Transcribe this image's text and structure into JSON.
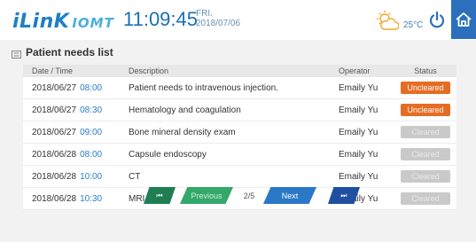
{
  "header": {
    "logo_main": "iLinK",
    "logo_sub": "IOMT",
    "time": "11:09:45",
    "day": "FRI.",
    "date": "2018/07/06",
    "temperature": "25°C",
    "icons": {
      "weather": "partly-cloudy-icon",
      "power": "power-icon",
      "home": "home-icon"
    },
    "accent_color": "#2b6fbd"
  },
  "panel": {
    "title": "Patient needs list",
    "columns": {
      "datetime": "Date / Time",
      "description": "Description",
      "operator": "Operator",
      "status": "Status"
    },
    "rows": [
      {
        "date": "2018/06/27",
        "time": "08:00",
        "description": "Patient needs to intravenous injection.",
        "operator": "Emaily Yu",
        "status": "Uncleared"
      },
      {
        "date": "2018/06/27",
        "time": "08:30",
        "description": "Hematology and coagulation",
        "operator": "Emaily Yu",
        "status": "Uncleared"
      },
      {
        "date": "2018/06/27",
        "time": "09:00",
        "description": "Bone mineral density exam",
        "operator": "Emaily Yu",
        "status": "Cleared"
      },
      {
        "date": "2018/06/28",
        "time": "08:00",
        "description": "Capsule endoscopy",
        "operator": "Emaily Yu",
        "status": "Cleared"
      },
      {
        "date": "2018/06/28",
        "time": "10:00",
        "description": "CT",
        "operator": "Emaily Yu",
        "status": "Cleared"
      },
      {
        "date": "2018/06/28",
        "time": "10:30",
        "description": "MRI",
        "operator": "Emaily Yu",
        "status": "Cleared"
      }
    ],
    "status_colors": {
      "uncleared": "#e66c24",
      "cleared": "#c9c9c9"
    }
  },
  "pager": {
    "first_label": "⏮",
    "previous_label": "Previous",
    "page_indicator": "2/5",
    "next_label": "Next",
    "last_label": "⏭"
  }
}
